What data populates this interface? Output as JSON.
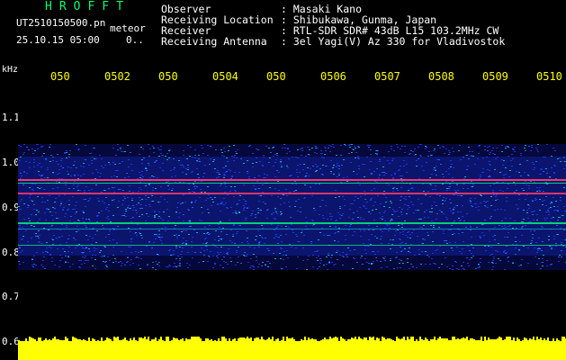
{
  "header": {
    "app_title": "HROFFT",
    "file_name": "UT2510150500.pn",
    "label_meteor": "meteor",
    "datetime": "25.10.15 05:00",
    "dots": "0..",
    "info": [
      {
        "label": "Observer",
        "value": ": Masaki Kano"
      },
      {
        "label": "Receiving Location",
        "value": ": Shibukawa, Gunma, Japan"
      },
      {
        "label": "Receiver",
        "value": ": RTL-SDR SDR# 43dB L15 103.2MHz CW"
      },
      {
        "label": "Receiving Antenna",
        "value": ": 3el Yagi(V) Az 330 for Vladivostok"
      }
    ]
  },
  "axis": {
    "unit": "kHz",
    "time_ticks": [
      "050",
      "0502",
      "050",
      "0504",
      "050",
      "0506",
      "0507",
      "0508",
      "0509",
      "0510"
    ],
    "freq_ticks": [
      "1.1",
      "1.0",
      "0.9",
      "0.8",
      "0.7",
      "0.6"
    ]
  },
  "colors": {
    "background": "#000000",
    "text": "#ffffff",
    "title": "#00ff6a",
    "tick": "#ffff00",
    "noise_floor": "#ffff00",
    "signal_strong": "#ff3a6a",
    "signal_mid": "#00ff7a",
    "signal_low": "#1f3bff"
  }
}
